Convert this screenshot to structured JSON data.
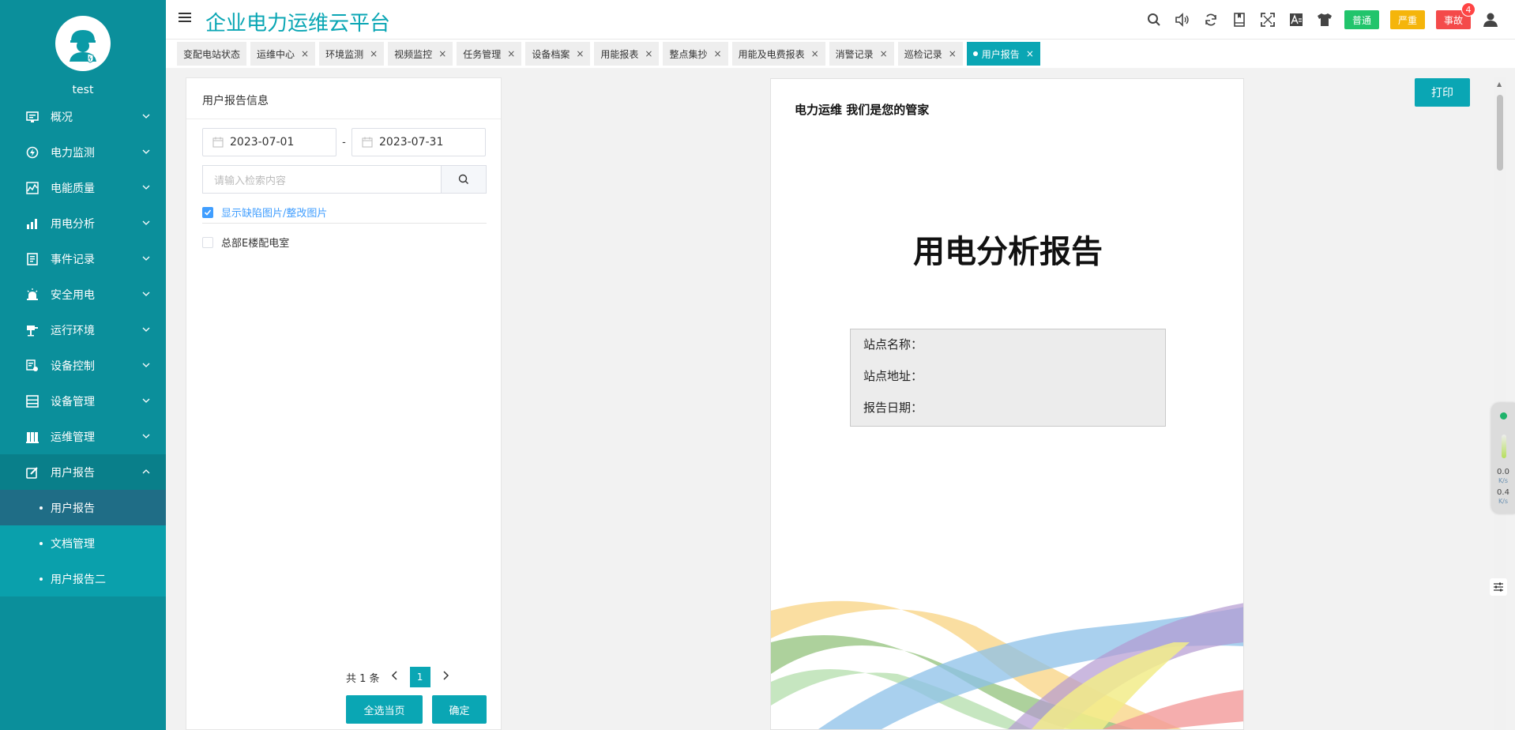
{
  "app": {
    "title": "企业电力运维云平台"
  },
  "user": {
    "name": "test"
  },
  "sidebar": {
    "items": [
      {
        "label": "概况",
        "icon": "overview-icon"
      },
      {
        "label": "电力监测",
        "icon": "power-monitor-icon"
      },
      {
        "label": "电能质量",
        "icon": "power-quality-icon"
      },
      {
        "label": "用电分析",
        "icon": "analysis-icon"
      },
      {
        "label": "事件记录",
        "icon": "event-log-icon"
      },
      {
        "label": "安全用电",
        "icon": "safety-icon"
      },
      {
        "label": "运行环境",
        "icon": "environment-icon"
      },
      {
        "label": "设备控制",
        "icon": "device-control-icon"
      },
      {
        "label": "设备管理",
        "icon": "device-manage-icon"
      },
      {
        "label": "运维管理",
        "icon": "ops-manage-icon"
      },
      {
        "label": "用户报告",
        "icon": "user-report-icon"
      }
    ],
    "submenu": [
      {
        "label": "用户报告"
      },
      {
        "label": "文档管理"
      },
      {
        "label": "用户报告二"
      }
    ]
  },
  "header": {
    "levels": {
      "normal": "普通",
      "serious": "严重",
      "accident": "事故"
    },
    "accident_count": "4",
    "colors": {
      "normal": "#21c46b",
      "serious": "#f5b50b",
      "accident": "#f44a4a",
      "accent": "#0aa6b4"
    }
  },
  "tabs": [
    {
      "label": "变配电站状态"
    },
    {
      "label": "运维中心"
    },
    {
      "label": "环境监测"
    },
    {
      "label": "视频监控"
    },
    {
      "label": "任务管理"
    },
    {
      "label": "设备档案"
    },
    {
      "label": "用能报表"
    },
    {
      "label": "整点集抄"
    },
    {
      "label": "用能及电费报表"
    },
    {
      "label": "消警记录"
    },
    {
      "label": "巡检记录"
    },
    {
      "label": "用户报告"
    }
  ],
  "panel": {
    "title": "用户报告信息",
    "date_start": "2023-07-01",
    "date_sep": "-",
    "date_end": "2023-07-31",
    "search_placeholder": "请输入检索内容",
    "show_defect_label": "显示缺陷图片/整改图片",
    "station_label": "总部E楼配电室",
    "total_text": "共 1 条",
    "page": "1",
    "select_page_btn": "全选当页",
    "confirm_btn": "确定"
  },
  "report": {
    "slogan": "电力运维 我们是您的管家",
    "title": "用电分析报告",
    "site_name_label": "站点名称：",
    "site_addr_label": "站点地址：",
    "report_date_label": "报告日期："
  },
  "print_btn": "打印",
  "monitor": {
    "up_value": "0.0",
    "up_unit": "K/s",
    "down_value": "0.4",
    "down_unit": "K/s"
  }
}
